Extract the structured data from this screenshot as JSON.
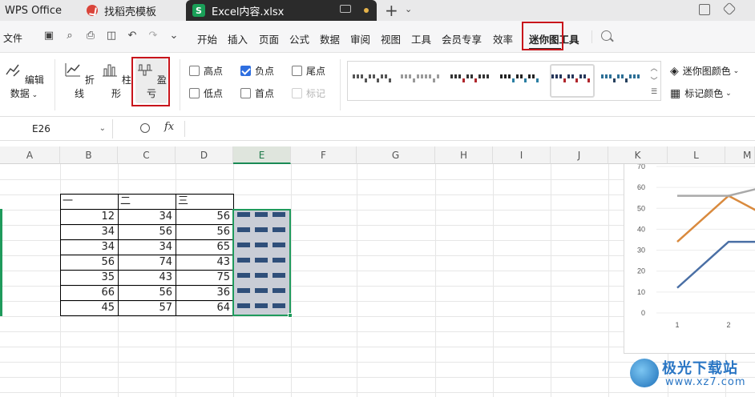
{
  "titlebar": {
    "app_name": "WPS Office",
    "tab_find": "找稻壳模板",
    "tab_excel_icon": "S",
    "tab_excel": "Excel内容.xlsx"
  },
  "menubar": {
    "file": "文件",
    "items": [
      "开始",
      "插入",
      "页面",
      "公式",
      "数据",
      "审阅",
      "视图",
      "工具",
      "会员专享",
      "效率"
    ],
    "sparkline": "迷你图",
    "tools": "工具"
  },
  "ribbon": {
    "edit_data": "编辑数据",
    "line": "折线",
    "column": "柱形",
    "winloss": "盈亏",
    "checks": [
      {
        "label": "高点",
        "checked": false
      },
      {
        "label": "负点",
        "checked": true
      },
      {
        "label": "尾点",
        "checked": false
      },
      {
        "label": "低点",
        "checked": false
      },
      {
        "label": "首点",
        "checked": false
      },
      {
        "label": "标记",
        "checked": false,
        "disabled": true
      }
    ],
    "sparkline_color": "迷你图颜色",
    "marker_color": "标记颜色"
  },
  "formula_bar": {
    "name_box": "E26",
    "fx": "fx"
  },
  "columns": [
    "A",
    "B",
    "C",
    "D",
    "E",
    "F",
    "G",
    "H",
    "I",
    "J",
    "K",
    "L",
    "M"
  ],
  "table": {
    "headers": [
      "一",
      "二",
      "三"
    ],
    "rows": [
      [
        12,
        34,
        56
      ],
      [
        34,
        56,
        56
      ],
      [
        34,
        34,
        65
      ],
      [
        56,
        74,
        43
      ],
      [
        35,
        43,
        75
      ],
      [
        66,
        56,
        36
      ],
      [
        45,
        57,
        64
      ]
    ]
  },
  "chart_data": {
    "type": "line",
    "y_ticks": [
      "70",
      "60",
      "50",
      "40",
      "30",
      "20",
      "10",
      "0"
    ],
    "x_ticks": [
      "1",
      "2"
    ],
    "ylim": [
      0,
      70
    ],
    "series": [
      {
        "color": "#4a6fa5",
        "values": [
          12,
          34,
          34
        ]
      },
      {
        "color": "#d98a3e",
        "values": [
          34,
          56,
          43
        ]
      },
      {
        "color": "#a9a9a9",
        "values": [
          56,
          56,
          62
        ]
      }
    ]
  },
  "watermark": {
    "line1": "极光下载站",
    "line2": "www.xz7.com"
  }
}
